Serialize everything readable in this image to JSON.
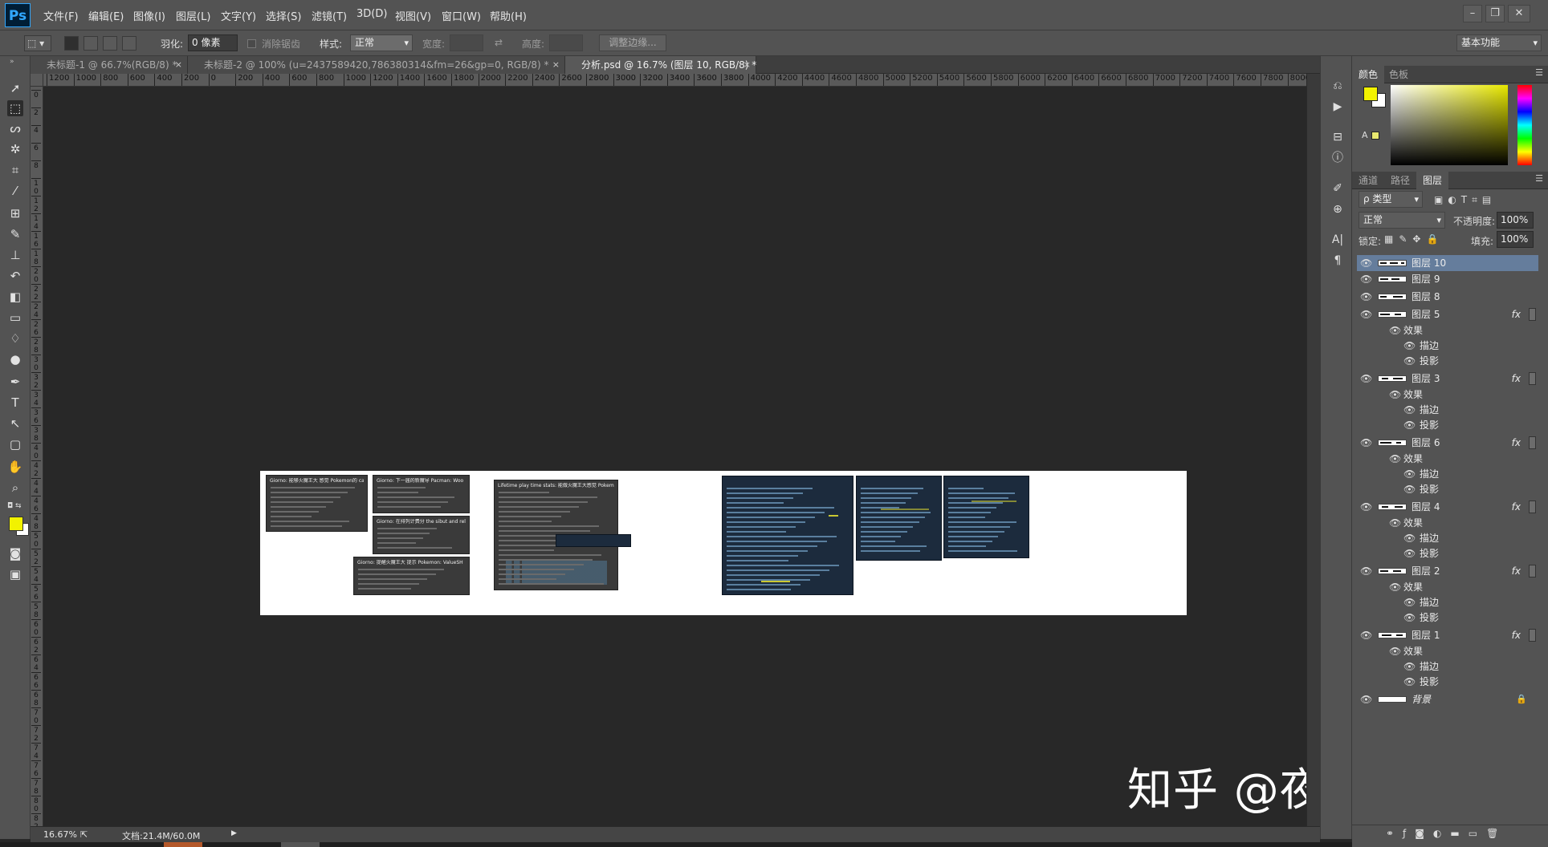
{
  "app": {
    "logo": "Ps"
  },
  "menu": [
    "文件(F)",
    "编辑(E)",
    "图像(I)",
    "图层(L)",
    "文字(Y)",
    "选择(S)",
    "滤镜(T)",
    "3D(D)",
    "视图(V)",
    "窗口(W)",
    "帮助(H)"
  ],
  "options": {
    "feather_label": "羽化:",
    "feather_value": "0 像素",
    "antialias_label": "消除锯齿",
    "style_label": "样式:",
    "style_value": "正常",
    "width_label": "宽度:",
    "height_label": "高度:",
    "refine_edge": "调整边缘...",
    "workspace": "基本功能"
  },
  "tabs": [
    {
      "label": "未标题-1 @ 66.7%(RGB/8) *",
      "close": "×"
    },
    {
      "label": "未标题-2 @ 100% (u=2437589420,786380314&fm=26&gp=0, RGB/8) *",
      "close": "×"
    },
    {
      "label": "分析.psd @ 16.7% (图层 10, RGB/8) *",
      "close": "×"
    }
  ],
  "ruler_h": [
    "1200",
    "1000",
    "800",
    "600",
    "400",
    "200",
    "0",
    "200",
    "400",
    "600",
    "800",
    "1000",
    "1200",
    "1400",
    "1600",
    "1800",
    "2000",
    "2200",
    "2400",
    "2600",
    "2800",
    "3000",
    "3200",
    "3400",
    "3600",
    "3800",
    "4000",
    "4200",
    "4400",
    "4600",
    "4800",
    "5000",
    "5200",
    "5400",
    "5600",
    "5800",
    "6000",
    "6200",
    "6400",
    "6600",
    "6800",
    "7000",
    "7200",
    "7400",
    "7600",
    "7800",
    "8000"
  ],
  "ruler_v": [
    "0",
    "2",
    "4",
    "6",
    "8",
    "1 0",
    "1 2",
    "1 4",
    "1 6",
    "1 8",
    "2 0",
    "2 2",
    "2 4",
    "2 6",
    "2 8",
    "3 0",
    "3 2",
    "3 4",
    "3 6",
    "3 8",
    "4 0",
    "4 2",
    "4 4",
    "4 6",
    "4 8",
    "5 0",
    "5 2",
    "5 4",
    "5 6",
    "5 8",
    "6 0",
    "6 2",
    "6 4",
    "6 6",
    "6 8",
    "7 0",
    "7 2",
    "7 4",
    "7 6",
    "7 8",
    "8 0",
    "8 2"
  ],
  "thumbs": [
    "Giorno: 能够火魔王大 感觉 Pokemon的 capturam",
    "Giorno: 下一届的新魔导 Pacman: Woo",
    "Giorno: 在排列计费分 the sibut and relatence",
    "Giorno: 提醒火魔王大 提示 Pokemon: ValueSH",
    "Lifetime play time stats: 能做火魔王大感觉 Pokemon的 capturam"
  ],
  "status": {
    "zoom": "16.67%",
    "doc": "文档:21.4M/60.0M"
  },
  "panels": {
    "color_tabs": [
      "颜色",
      "色板"
    ],
    "layer_tabs": [
      "通道",
      "路径",
      "图层"
    ],
    "filter": "ρ 类型",
    "blend_mode": "正常",
    "opacity_label": "不透明度:",
    "opacity_value": "100%",
    "lock_label": "锁定:",
    "fill_label": "填充:",
    "fill_value": "100%",
    "fx": "fx",
    "effects": "效果",
    "stroke": "描边",
    "shadow": "投影",
    "layers": [
      {
        "name": "图层 10",
        "selected": true,
        "fx": false
      },
      {
        "name": "图层 9",
        "selected": false,
        "fx": false
      },
      {
        "name": "图层 8",
        "selected": false,
        "fx": false
      },
      {
        "name": "图层 5",
        "selected": false,
        "fx": true
      },
      {
        "name": "图层 3",
        "selected": false,
        "fx": true
      },
      {
        "name": "图层 6",
        "selected": false,
        "fx": true
      },
      {
        "name": "图层 4",
        "selected": false,
        "fx": true
      },
      {
        "name": "图层 2",
        "selected": false,
        "fx": true
      },
      {
        "name": "图层 1",
        "selected": false,
        "fx": true
      },
      {
        "name": "背景",
        "selected": false,
        "fx": false
      }
    ]
  },
  "watermark": "知乎 @夜神不说话",
  "colors": {
    "foreground": "#f2f200",
    "background": "#ffffff",
    "selection": "#657d9c"
  }
}
